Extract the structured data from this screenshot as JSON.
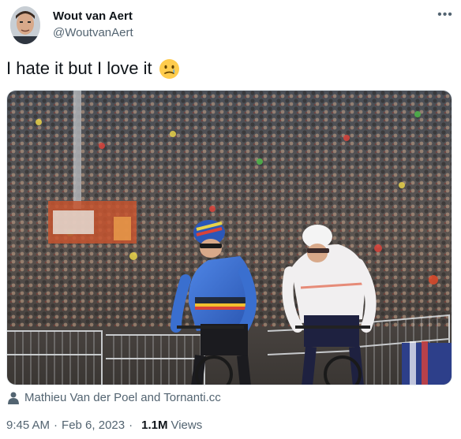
{
  "author": {
    "name": "Wout van Aert",
    "handle": "@WoutvanAert"
  },
  "more_icon": "more-horizontal-icon",
  "tweet": {
    "text": "I hate it but I love it",
    "emoji": "face-holding-back-tears"
  },
  "media_credit": {
    "icon": "person-icon",
    "text": "Mathieu Van der Poel and Tornanti.cc"
  },
  "meta": {
    "time": "9:45 AM",
    "separator": "·",
    "date": "Feb 6, 2023",
    "views_count": "1.1M",
    "views_label": "Views"
  },
  "colors": {
    "text": "#0f1419",
    "secondary": "#536471",
    "jersey_belgium": "#3a6fcf",
    "jersey_netherlands": "#f2f2f2"
  }
}
